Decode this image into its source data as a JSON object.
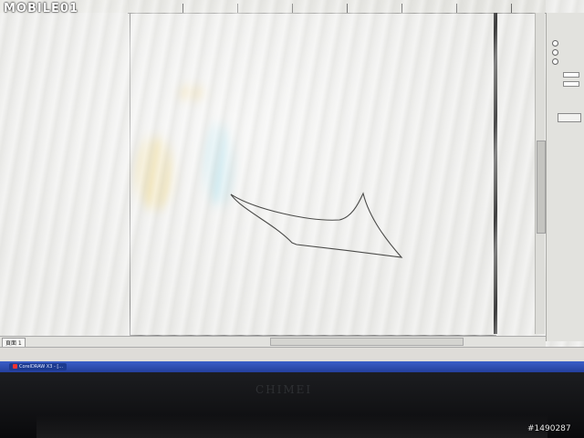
{
  "watermark": {
    "logo": "MOBILE01",
    "photo_id": "#1490287"
  },
  "canvas": {
    "page_tab": "頁面 1",
    "shape": "closed-curve-outline"
  },
  "docker": {
    "options": [
      "",
      "",
      ""
    ],
    "field1_label": "",
    "field1_value": "",
    "field2_label": "",
    "field2_value": "",
    "apply_label": ""
  },
  "status_bar": {
    "text": "",
    "right": ""
  },
  "taskbar": {
    "item": "CorelDRAW X3 - [..."
  },
  "monitor": {
    "brand": "CHIMEI"
  },
  "colors": {
    "screen": "#ececea",
    "taskbar": "#2f4fb4",
    "bezel": "#141518",
    "shape_stroke": "#4a4a48"
  }
}
